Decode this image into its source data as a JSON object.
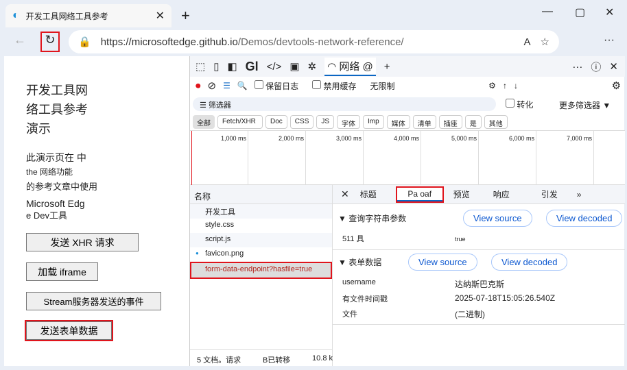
{
  "browser": {
    "tab_title": "开发工具网络工具参考",
    "url_host": "https://microsoftedge.github.io",
    "url_path": "/Demos/devtools-network-reference/"
  },
  "page": {
    "heading": [
      "开发工具网",
      "络工具参考",
      "演示"
    ],
    "desc": [
      "此演示页在 中",
      "the  网络功能",
      "的参考文章中使用",
      "Microsoft Edg",
      "e Dev工具"
    ],
    "buttons": [
      "发送 XHR 请求",
      "加载 iframe",
      "Stream服务器发送的事件",
      "发送表单数据"
    ]
  },
  "devtools": {
    "tabs": [
      "Gl",
      "网络 @"
    ],
    "preserve_log": "保留日志",
    "disable_cache": "禁用缓存",
    "throttle": "无限制",
    "filter_placeholder": "筛选器",
    "invert": "转化",
    "more_filters": "更多筛选器",
    "types": [
      "全部",
      "Fetch/XHR",
      "Doc",
      "CSS",
      "JS",
      "字体",
      "Imp",
      "媒体",
      "清单",
      "插座",
      "是",
      "其他"
    ],
    "timeline": [
      "1,000 ms",
      "2,000 ms",
      "3,000 ms",
      "4,000 ms",
      "5,000 ms",
      "6,000 ms",
      "7,000 ms"
    ],
    "name_header": "名称",
    "requests": [
      "开发工具",
      "style.css",
      "script.js",
      "favicon.png",
      "form-data-endpoint?hasfile=true"
    ],
    "status": {
      "requests": "5 文档。请求",
      "transferred": "B已转移",
      "size": "10.8 k"
    },
    "detail_tabs": [
      "标题",
      "Pa oaf",
      "预览",
      "响应",
      "引发"
    ],
    "query": {
      "title": "查询字符串参数",
      "key": "511 具",
      "value": "true"
    },
    "form": {
      "title": "表单数据",
      "rows": [
        {
          "k": "username",
          "v": "达纳斯巴克斯"
        },
        {
          "k": "有文件时间戳",
          "v": "2025-07-18T15:05:26.540Z"
        },
        {
          "k": "文件",
          "v": "(二进制)"
        }
      ]
    },
    "view_source": "View source",
    "view_decoded": "View decoded"
  }
}
